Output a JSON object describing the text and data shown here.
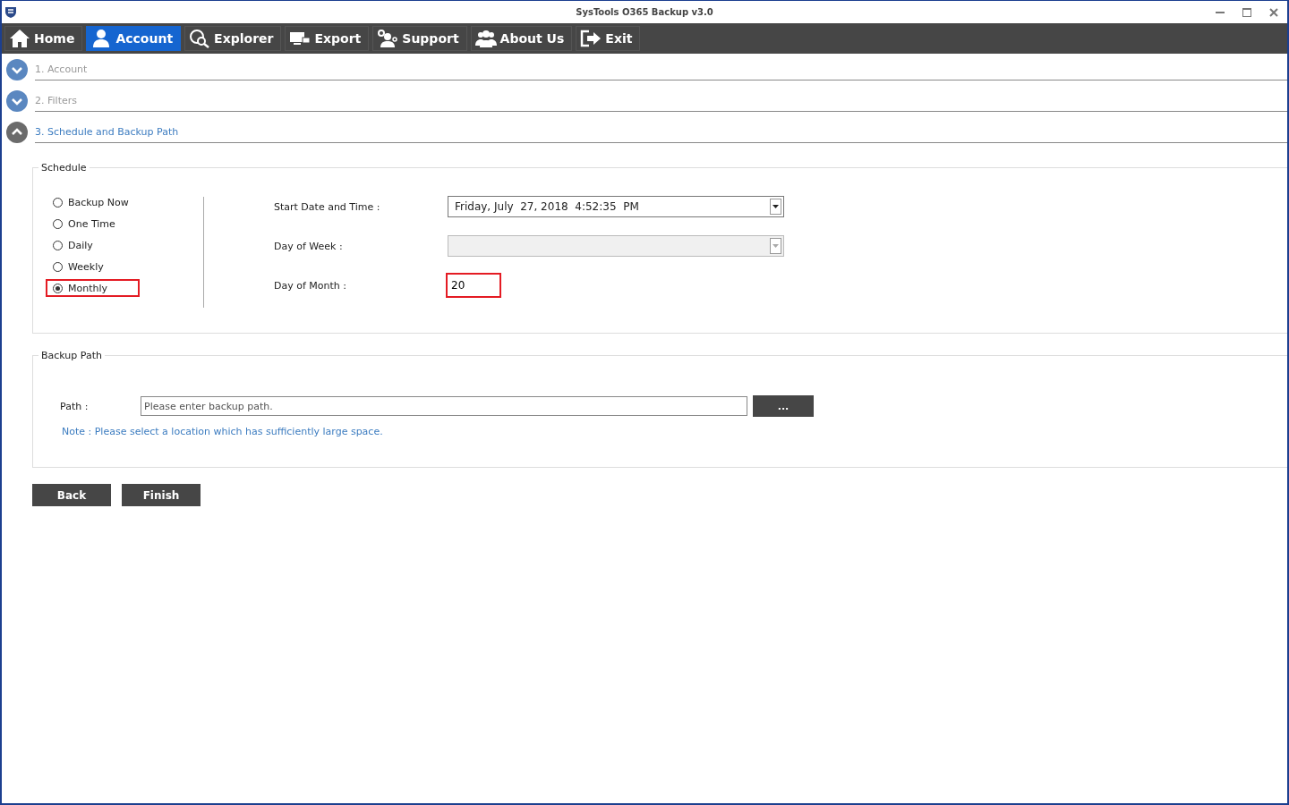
{
  "window": {
    "title": "SysTools O365 Backup v3.0"
  },
  "toolbar": [
    {
      "label": "Home",
      "kind": "home",
      "selected": false
    },
    {
      "label": "Account",
      "kind": "account",
      "selected": true
    },
    {
      "label": "Explorer",
      "kind": "explorer",
      "selected": false
    },
    {
      "label": "Export",
      "kind": "export",
      "selected": false
    },
    {
      "label": "Support",
      "kind": "support",
      "selected": false
    },
    {
      "label": "About Us",
      "kind": "about",
      "selected": false
    },
    {
      "label": "Exit",
      "kind": "exit",
      "selected": false
    }
  ],
  "steps": [
    {
      "label": "1. Account",
      "expanded": false
    },
    {
      "label": "2. Filters",
      "expanded": false
    },
    {
      "label": "3. Schedule and Backup Path",
      "expanded": true
    }
  ],
  "schedule": {
    "legend": "Schedule",
    "options": [
      {
        "label": "Backup Now",
        "selected": false,
        "highlighted": false
      },
      {
        "label": "One Time",
        "selected": false,
        "highlighted": false
      },
      {
        "label": "Daily",
        "selected": false,
        "highlighted": false
      },
      {
        "label": "Weekly",
        "selected": false,
        "highlighted": false
      },
      {
        "label": "Monthly",
        "selected": true,
        "highlighted": true
      }
    ],
    "start": {
      "label": "Start Date and Time :",
      "value": "Friday, July  27, 2018  4:52:35  PM",
      "disabled": false
    },
    "day_of_week": {
      "label": "Day  of Week :",
      "disabled": true
    },
    "day_of_month": {
      "label": "Day  of  Month :",
      "value": "20",
      "highlighted": true
    }
  },
  "backup_path": {
    "legend": "Backup Path",
    "label": "Path :",
    "placeholder": "Please enter backup path.",
    "browse_label": "...",
    "note": "Note : Please select a location which has sufficiently large space."
  },
  "buttons": [
    "Back",
    "Finish"
  ]
}
